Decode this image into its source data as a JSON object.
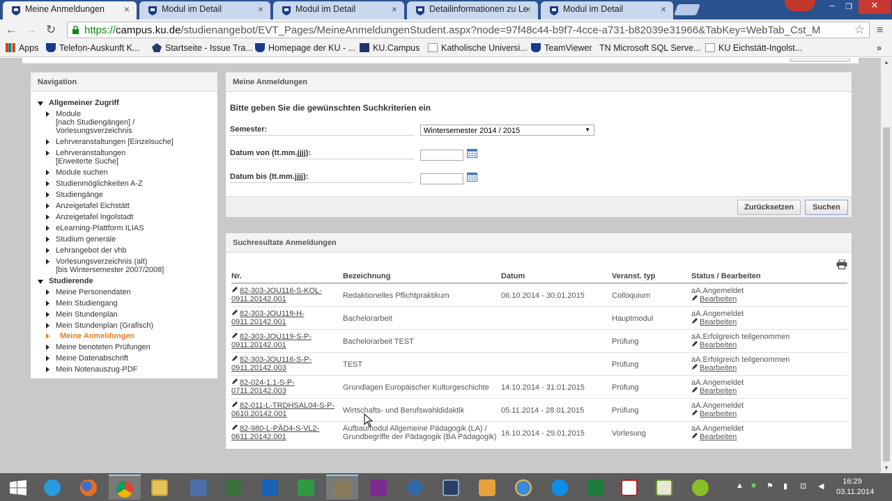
{
  "browser": {
    "tabs": [
      {
        "title": "Meine Anmeldungen",
        "active": true
      },
      {
        "title": "Modul im Detail",
        "active": false
      },
      {
        "title": "Modul im Detail",
        "active": false
      },
      {
        "title": "Detailinformationen zu Le",
        "active": false
      },
      {
        "title": "Modul im Detail",
        "active": false
      }
    ],
    "url": {
      "scheme": "https://",
      "host": "campus.ku.de",
      "path": "/studienangebot/EVT_Pages/MeineAnmeldungenStudent.aspx?node=97f48c44-b9f7-4cce-a731-b82039e31966&TabKey=WebTab_Cst_M"
    },
    "bookmarks": [
      "Apps",
      "Telefon-Auskunft K...",
      "Startseite - Issue Tra...",
      "Homepage der KU - ...",
      "KU.Campus",
      "Katholische Universi...",
      "TeamViewer",
      "TN Microsoft SQL Serve...",
      "KU Eichstätt-Ingolst..."
    ],
    "overflow_label": "»"
  },
  "navigation": {
    "title": "Navigation",
    "sections": [
      {
        "label": "Allgemeiner Zugriff",
        "items": [
          "Module\n[nach Studiengängen] /\nVorlesungsverzeichnis",
          "Lehrveranstaltungen [Einzelsuche]",
          "Lehrveranstaltungen\n[Erweiterte Suche]",
          "Module suchen",
          "Studienmöglichkeiten A-Z",
          "Studiengänge",
          "Anzeigetafel Eichstätt",
          "Anzeigetafel Ingolstadt",
          "eLearning-Plattform ILIAS",
          "Studium generale",
          "Lehrangebot der vhb",
          "Vorlesungsverzeichnis (alt)\n[bis Wintersemester 2007/2008]"
        ]
      },
      {
        "label": "Studierende",
        "items": [
          "Meine Personendaten",
          "Mein Studiengang",
          "Mein Stundenplan",
          "Mein Stundenplan (Grafisch)",
          "Meine Anmeldungen",
          "Meine benoteten Prüfungen",
          "Meine Datenabschrift",
          "Mein Notenauszug-PDF"
        ]
      }
    ]
  },
  "search": {
    "title": "Meine Anmeldungen",
    "prompt": "Bitte geben Sie die gewünschten Suchkriterien ein",
    "semester_label": "Semester:",
    "semester_value": "Wintersemester 2014 / 2015",
    "date_from_label": "Datum von (tt.mm.jjjj):",
    "date_to_label": "Datum bis (tt.mm.jjjj):",
    "date_from_value": "",
    "date_to_value": "",
    "reset_label": "Zurücksetzen",
    "search_label": "Suchen"
  },
  "results": {
    "title": "Suchresultate Anmeldungen",
    "columns": [
      "Nr.",
      "Bezeichnung",
      "Datum",
      "Veranst. typ",
      "Status / Bearbeiten"
    ],
    "edit_label": "Bearbeiten",
    "rows": [
      {
        "nr1": "82-303-JOU116-S-KOL-",
        "nr2": "0911.20142.001",
        "bez": "Redaktionelles Pflichtpraktikum",
        "datum": "06.10.2014 - 30.01.2015",
        "typ": "Colloquium",
        "status": "aA.Angemeldet"
      },
      {
        "nr1": "82-303-JOU119-H-",
        "nr2": "0911.20142.001",
        "bez": "Bachelorarbeit",
        "datum": "",
        "typ": "Hauptmodul",
        "status": "aA.Angemeldet"
      },
      {
        "nr1": "82-303-JOU119-S-P-",
        "nr2": "0911.20142.001",
        "bez": "Bachelorarbeit TEST",
        "datum": "",
        "typ": "Prüfung",
        "status": "aA.Erfolgreich teilgenommen"
      },
      {
        "nr1": "82-303-JOU116-S-P-",
        "nr2": "0911.20142.003",
        "bez": "TEST",
        "datum": "",
        "typ": "Prüfung",
        "status": "aA.Erfolgreich teilgenommen"
      },
      {
        "nr1": "82-024-1.1-S-P-",
        "nr2": "0711.20142.003",
        "bez": "Grundlagen Europäischer Kulturgeschichte",
        "datum": "14.10.2014 - 31.01.2015",
        "typ": "Prüfung",
        "status": "aA.Angemeldet"
      },
      {
        "nr1": "82-011-L-TRDHSAL04-S-P-",
        "nr2": "0610.20142.001",
        "bez": "Wirtschafts- und Berufswahldidaktik",
        "datum": "05.11.2014 - 28.01.2015",
        "typ": "Prüfung",
        "status": "aA.Angemeldet"
      },
      {
        "nr1": "82-980-L-PÄD4-S-VL2-",
        "nr2": "0611.20142.001",
        "bez": "Aufbaumodul Allgemeine Pädagogik (LA) /\nGrundbegriffe der Pädagogik (BA Pädagogik)",
        "datum": "16.10.2014 - 29.01.2015",
        "typ": "Vorlesung",
        "status": "aA.Angemeldet"
      }
    ]
  },
  "taskbar": {
    "clock_time": "16:29",
    "clock_date": "03.11.2014",
    "apps": [
      "start",
      "internet-explorer",
      "firefox",
      "chrome",
      "file-explorer",
      "remote-desktop",
      "network-tool",
      "outlook",
      "camtasia",
      "gimp",
      "onenote",
      "virtualbox",
      "rdp-manager",
      "file-transfer",
      "compass",
      "teamviewer",
      "excel",
      "acrobat",
      "word-processor",
      "greenshot"
    ]
  },
  "colors": {
    "tabbar": "#2a5291",
    "active_nav": "#e87d1e",
    "page_bg": "#c9c9c9",
    "url_scheme": "#0a8a0a"
  }
}
